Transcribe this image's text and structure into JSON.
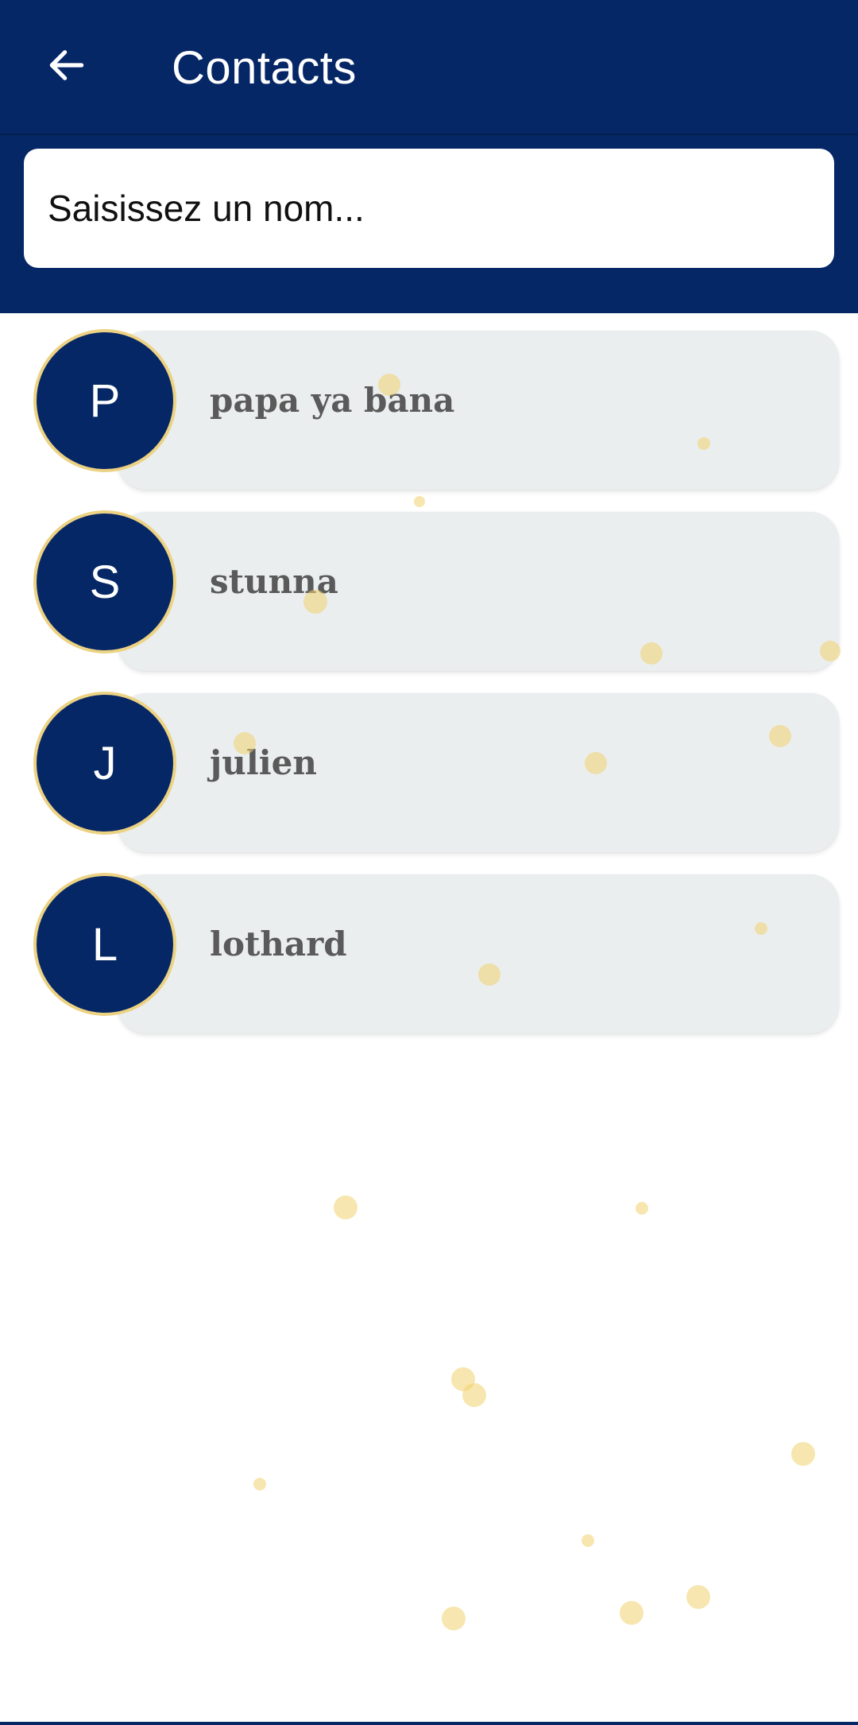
{
  "header": {
    "title": "Contacts",
    "back_icon": "arrow-left-icon",
    "background_color": "#062766"
  },
  "search": {
    "placeholder": "Saisissez un nom..."
  },
  "contacts": [
    {
      "initial": "P",
      "name": "papa ya bana"
    },
    {
      "initial": "S",
      "name": "stunna"
    },
    {
      "initial": "J",
      "name": "julien"
    },
    {
      "initial": "L",
      "name": "lothard"
    }
  ],
  "colors": {
    "primary": "#062766",
    "avatar_border": "#ecd283",
    "card_background": "#ebeeef",
    "name_text": "#5a5a5a",
    "decoration_dots": "#f0d26e"
  }
}
